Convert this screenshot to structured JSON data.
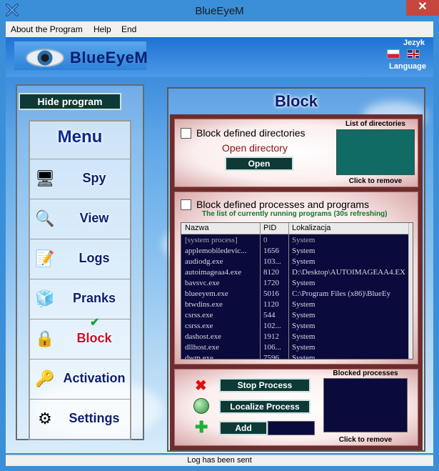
{
  "window": {
    "title": "BlueEyeM",
    "close_glyph": "✕"
  },
  "menu_bar": {
    "items": [
      "About the Program",
      "Help",
      "End"
    ]
  },
  "header": {
    "logo_text": "BlueEyeM",
    "language_label": "Jezyk",
    "language_sub": "Language",
    "flags": [
      "pl-flag",
      "en-flag"
    ]
  },
  "sidebar": {
    "hide_button": "Hide program",
    "menu_title": "Menu",
    "items": [
      {
        "label": "Spy",
        "icon": "monitor-icon"
      },
      {
        "label": "View",
        "icon": "magnifier-icon"
      },
      {
        "label": "Logs",
        "icon": "notepad-icon"
      },
      {
        "label": "Pranks",
        "icon": "blocks-icon"
      },
      {
        "label": "Block",
        "icon": "padlock-icon",
        "active": true
      },
      {
        "label": "Activation",
        "icon": "keys-icon"
      },
      {
        "label": "Settings",
        "icon": "gears-icon"
      }
    ]
  },
  "block": {
    "title": "Block",
    "directories": {
      "checkbox_label": "Block defined directories",
      "open_directory_text": "Open directory",
      "open_button": "Open",
      "list_title": "List of directories",
      "list_caption": "Click to remove"
    },
    "processes": {
      "checkbox_label": "Block defined processes and programs",
      "subtitle": "The list of currently running programs (30s refreshing)",
      "columns": [
        "Nazwa",
        "PID",
        "Lokalizacja"
      ],
      "rows": [
        [
          "[system process]",
          "0",
          "System"
        ],
        [
          "applemobiledevic...",
          "1656",
          "System"
        ],
        [
          "audiodg.exe",
          "103...",
          "System"
        ],
        [
          "autoimageaa4.exe",
          "8120",
          "D:\\Desktop\\AUTOIMAGEAA4.EX"
        ],
        [
          "bavsvc.exe",
          "1720",
          "System"
        ],
        [
          "blueeyem.exe",
          "5016",
          "C:\\Program Files (x86)\\BlueEy"
        ],
        [
          "btwdins.exe",
          "1120",
          "System"
        ],
        [
          "csrss.exe",
          "544",
          "System"
        ],
        [
          "csrss.exe",
          "102...",
          "System"
        ],
        [
          "dashost.exe",
          "1912",
          "System"
        ],
        [
          "dllhost.exe",
          "106...",
          "System"
        ],
        [
          "dwm.exe",
          "7596",
          "System"
        ]
      ]
    },
    "actions": {
      "stop_button": "Stop Process",
      "localize_button": "Localize Process",
      "add_button": "Add",
      "add_input_value": "",
      "blocked_title": "Blocked processes",
      "blocked_caption": "Click to remove"
    }
  },
  "status_bar": {
    "text": "Log has been sent"
  },
  "colors": {
    "accent_dark": "#0d3a36",
    "list_teal": "#0f6b63",
    "table_bg": "#0a0a3c",
    "nav_text": "#0b1e6e",
    "active_text": "#c8102e"
  }
}
